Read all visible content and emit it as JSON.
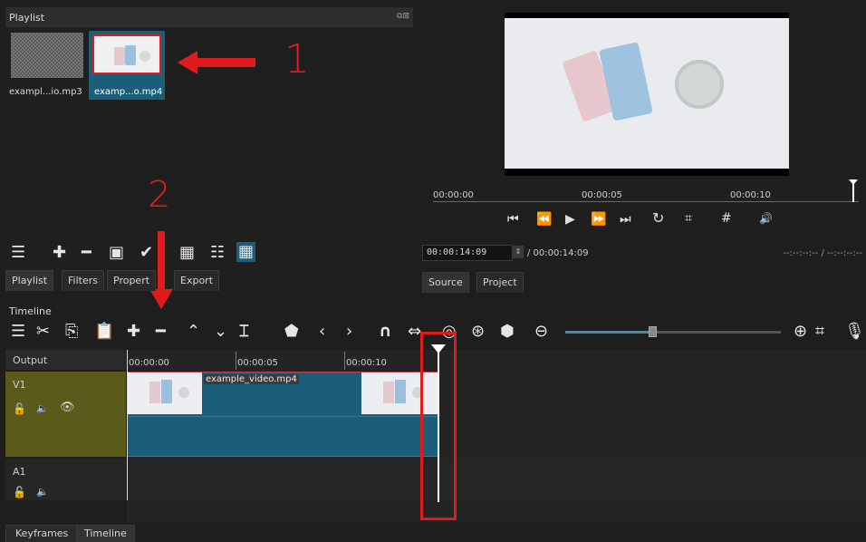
{
  "playlist": {
    "title": "Playlist",
    "items": [
      {
        "label": "exampl...io.mp3"
      },
      {
        "label": "examp...o.mp4"
      }
    ],
    "tabs": [
      "Playlist",
      "Filters",
      "Propert",
      "Export"
    ]
  },
  "annotations": {
    "step1": "1",
    "step2": "2"
  },
  "player": {
    "ruler_ticks": [
      "00:00:00",
      "00:00:05",
      "00:00:10"
    ],
    "timecode": "00:00:14:09",
    "duration": "/ 00:00:14:09",
    "in_out": "--:--:--:-- / --:--:--:--",
    "tabs": [
      "Source",
      "Project"
    ]
  },
  "timeline": {
    "title": "Timeline",
    "output_label": "Output",
    "ruler_ticks": [
      "00:00:00",
      "00:00:05",
      "00:00:10"
    ],
    "tracks": [
      {
        "name": "V1"
      },
      {
        "name": "A1"
      }
    ],
    "clip_label": "example_video.mp4"
  },
  "bottom_tabs": [
    "Keyframes",
    "Timeline"
  ],
  "colors": {
    "accent": "#1b5e7a",
    "highlight": "#e01b1b",
    "track_head": "#5a5a1a"
  }
}
